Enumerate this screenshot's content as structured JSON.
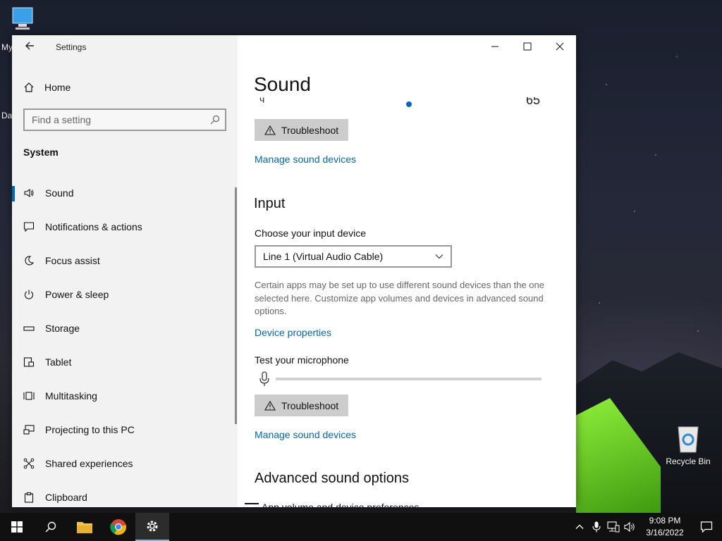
{
  "desktop": {
    "pc_label": "My",
    "da_label": "Da",
    "recycle_bin_label": "Recycle Bin"
  },
  "window": {
    "app_title": "Settings",
    "controls": [
      "minimize",
      "maximize",
      "close"
    ]
  },
  "sidebar": {
    "home_label": "Home",
    "search_placeholder": "Find a setting",
    "group_label": "System",
    "items": [
      {
        "label": "Sound",
        "icon": "speaker-icon",
        "active": true
      },
      {
        "label": "Notifications & actions",
        "icon": "message-icon"
      },
      {
        "label": "Focus assist",
        "icon": "moon-icon"
      },
      {
        "label": "Power & sleep",
        "icon": "power-icon"
      },
      {
        "label": "Storage",
        "icon": "storage-icon"
      },
      {
        "label": "Tablet",
        "icon": "tablet-icon"
      },
      {
        "label": "Multitasking",
        "icon": "multitasking-icon"
      },
      {
        "label": "Projecting to this PC",
        "icon": "projector-icon"
      },
      {
        "label": "Shared experiences",
        "icon": "shared-icon"
      },
      {
        "label": "Clipboard",
        "icon": "clipboard-icon"
      }
    ]
  },
  "main": {
    "title": "Sound",
    "partial_volume_value": "65",
    "output": {
      "troubleshoot_label": "Troubleshoot",
      "manage_link": "Manage sound devices"
    },
    "input": {
      "heading": "Input",
      "choose_label": "Choose your input device",
      "selected_device": "Line 1 (Virtual Audio Cable)",
      "description": "Certain apps may be set up to use different sound devices than the one selected here. Customize app volumes and devices in advanced sound options.",
      "device_properties_link": "Device properties",
      "test_mic_label": "Test your microphone",
      "mic_level": 0,
      "troubleshoot_label": "Troubleshoot",
      "manage_link": "Manage sound devices"
    },
    "advanced": {
      "heading": "Advanced sound options",
      "app_volume_label": "App volume and device preferences"
    }
  },
  "taskbar": {
    "time": "9:08 PM",
    "date": "3/16/2022",
    "accent": "#76b9ed"
  }
}
